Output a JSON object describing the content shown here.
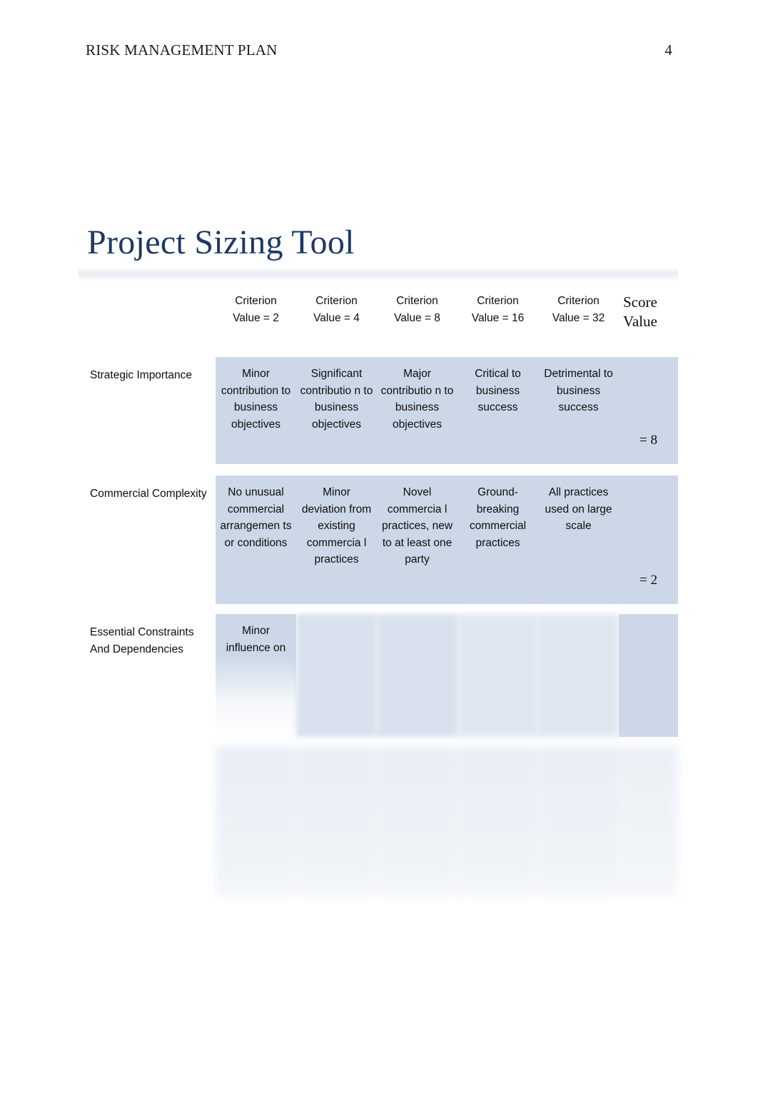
{
  "header": {
    "title": "RISK MANAGEMENT PLAN",
    "page_number": "4"
  },
  "title": "Project Sizing Tool",
  "colors": {
    "title": "#1f3864",
    "cell_background": "#ccd8e8",
    "page_background": "#ffffff",
    "text": "#0d0d0d"
  },
  "table": {
    "columns": [
      {
        "key": "label",
        "header": ""
      },
      {
        "key": "v2",
        "header": "Criterion Value = 2"
      },
      {
        "key": "v4",
        "header": "Criterion Value = 4"
      },
      {
        "key": "v8",
        "header": "Criterion Value = 8"
      },
      {
        "key": "v16",
        "header": "Criterion Value = 16"
      },
      {
        "key": "v32",
        "header": "Criterion Value = 32"
      },
      {
        "key": "score",
        "header": "Score Value"
      }
    ],
    "header_cells": {
      "blank": "",
      "c2_line1": "Criterion",
      "c2_line2": "Value = 2",
      "c4_line1": "Criterion",
      "c4_line2": "Value = 4",
      "c8_line1": "Criterion",
      "c8_line2": "Value = 8",
      "c16_line1": "Criterion",
      "c16_line2": "Value = 16",
      "c32_line1": "Criterion",
      "c32_line2": "Value = 32",
      "score_label": "Score Value"
    },
    "rows": [
      {
        "label": "Strategic Importance",
        "v2": "Minor contribution to business objectives",
        "v4": "Significant contributio n to business objectives",
        "v8": "Major contributio n to business objectives",
        "v16": "Critical to business success",
        "v32": "Detrimental to business success",
        "score": "= 8",
        "legible": true
      },
      {
        "label": "Commercial Complexity",
        "v2": "No unusual commercial arrangemen ts or conditions",
        "v4": "Minor deviation from existing commercia l practices",
        "v8": "Novel commercia l practices, new to at least one party",
        "v16": "Ground- breaking commercial practices",
        "v32": "All practices used on large scale",
        "score": "= 2",
        "legible": true
      },
      {
        "label": "Essential Constraints And Dependencies",
        "v2": "Minor influence on",
        "v4": "",
        "v8": "",
        "v16": "",
        "v32": "",
        "score": "",
        "legible": false
      },
      {
        "label": "",
        "v2": "",
        "v4": "",
        "v8": "",
        "v16": "",
        "v32": "",
        "score": "",
        "legible": false
      }
    ]
  }
}
